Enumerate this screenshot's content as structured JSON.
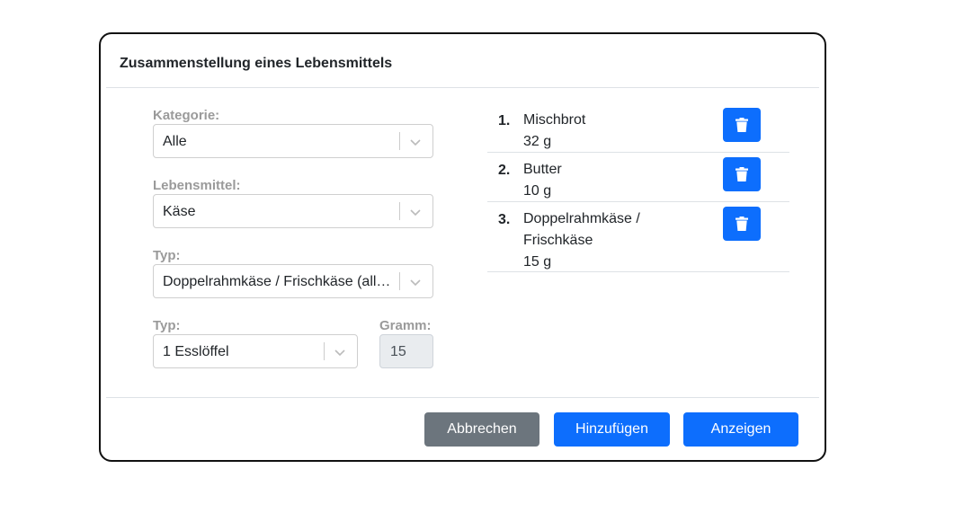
{
  "modal": {
    "title": "Zusammenstellung eines Lebensmittels"
  },
  "form": {
    "kategorie_label": "Kategorie:",
    "kategorie_value": "Alle",
    "lebensmittel_label": "Lebensmittel:",
    "lebensmittel_value": "Käse",
    "typ_label": "Typ:",
    "typ_value": "Doppelrahmkäse / Frischkäse (allge...",
    "portion_label": "Typ:",
    "portion_value": "1 Esslöffel",
    "gramm_label": "Gramm:",
    "gramm_value": "15"
  },
  "list": {
    "items": [
      {
        "num": "1.",
        "name": "Mischbrot",
        "amount": "32 g"
      },
      {
        "num": "2.",
        "name": "Butter",
        "amount": "10 g"
      },
      {
        "num": "3.",
        "name_line1": "Doppelrahmkäse /",
        "name_line2": "Frischkäse",
        "amount": "15 g"
      }
    ],
    "delete_icon": "trash-icon"
  },
  "footer": {
    "cancel_label": "Abbrechen",
    "add_label": "Hinzufügen",
    "show_label": "Anzeigen"
  },
  "colors": {
    "primary": "#0d6efd",
    "secondary": "#6c757d",
    "label_gray": "#9a9a9a"
  }
}
